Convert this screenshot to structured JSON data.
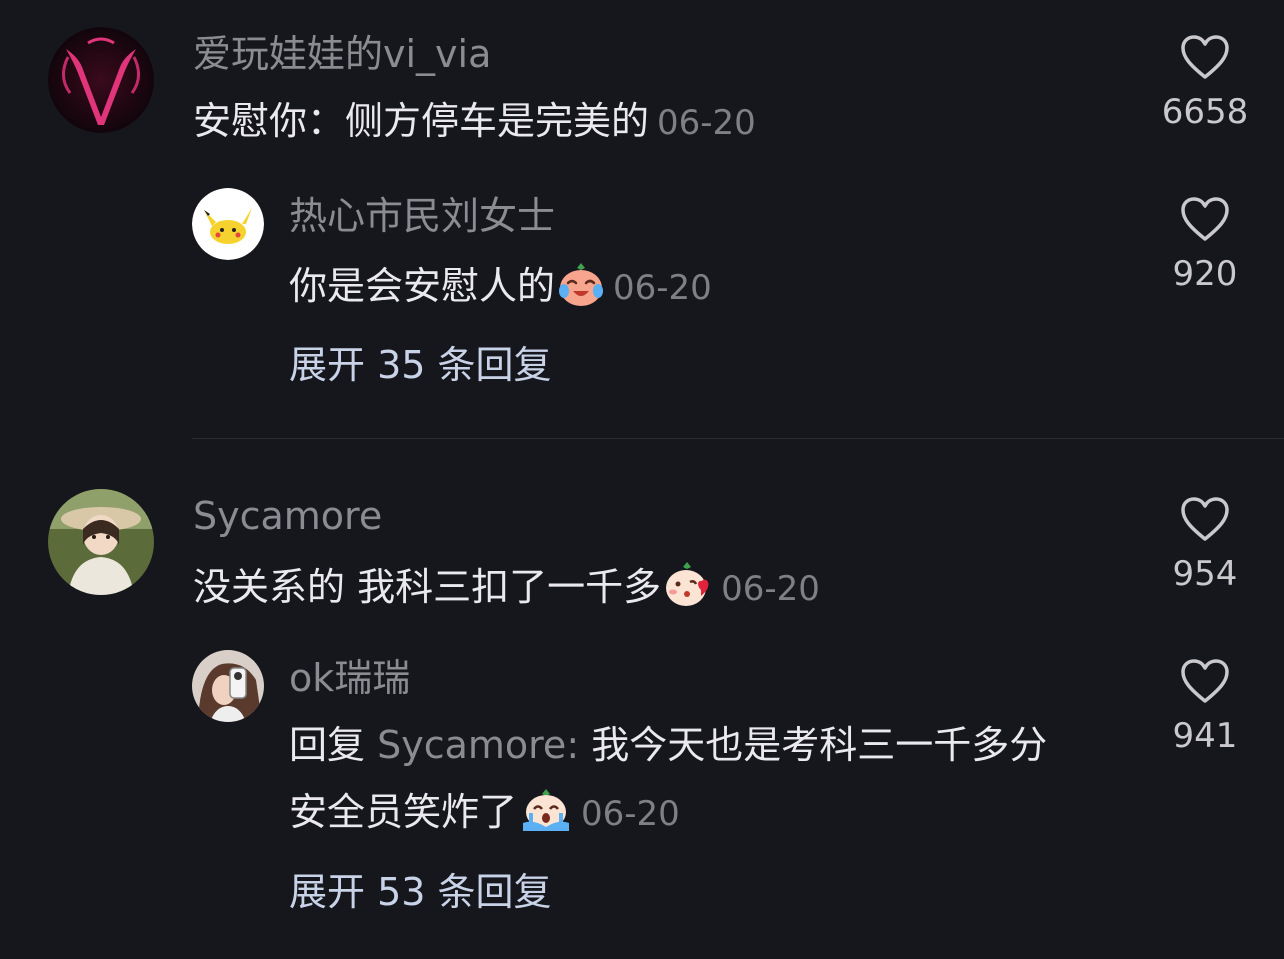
{
  "comments": [
    {
      "username": "爱玩娃娃的vi_via",
      "text": "安慰你：侧方停车是完美的",
      "date": "06-20",
      "likes": "6658",
      "avatar_icon": "pink-v-logo-avatar",
      "reply": {
        "username": "热心市民刘女士",
        "text": "你是会安慰人的",
        "emoji": "crying-laugh-emoji",
        "date": "06-20",
        "likes": "920",
        "avatar_icon": "pikachu-avatar"
      },
      "expand_label": "展开 35 条回复"
    },
    {
      "username": "Sycamore",
      "text": "没关系的 我科三扣了一千多",
      "emoji": "blow-kiss-emoji",
      "date": "06-20",
      "likes": "954",
      "avatar_icon": "girl-photo-avatar",
      "reply": {
        "username": "ok瑞瑞",
        "reply_prefix": "回复 ",
        "reply_target": "Sycamore:",
        "text_line1": " 我今天也是考科三一千多分",
        "text_line2": "安全员笑炸了",
        "emoji": "crying-sob-emoji",
        "date": "06-20",
        "likes": "941",
        "avatar_icon": "selfie-photo-avatar"
      },
      "expand_label": "展开 53 条回复"
    }
  ],
  "colors": {
    "background": "#16161d",
    "username": "#8b8b92",
    "text": "#e9e9ee",
    "expand": "#c9d3e8"
  }
}
